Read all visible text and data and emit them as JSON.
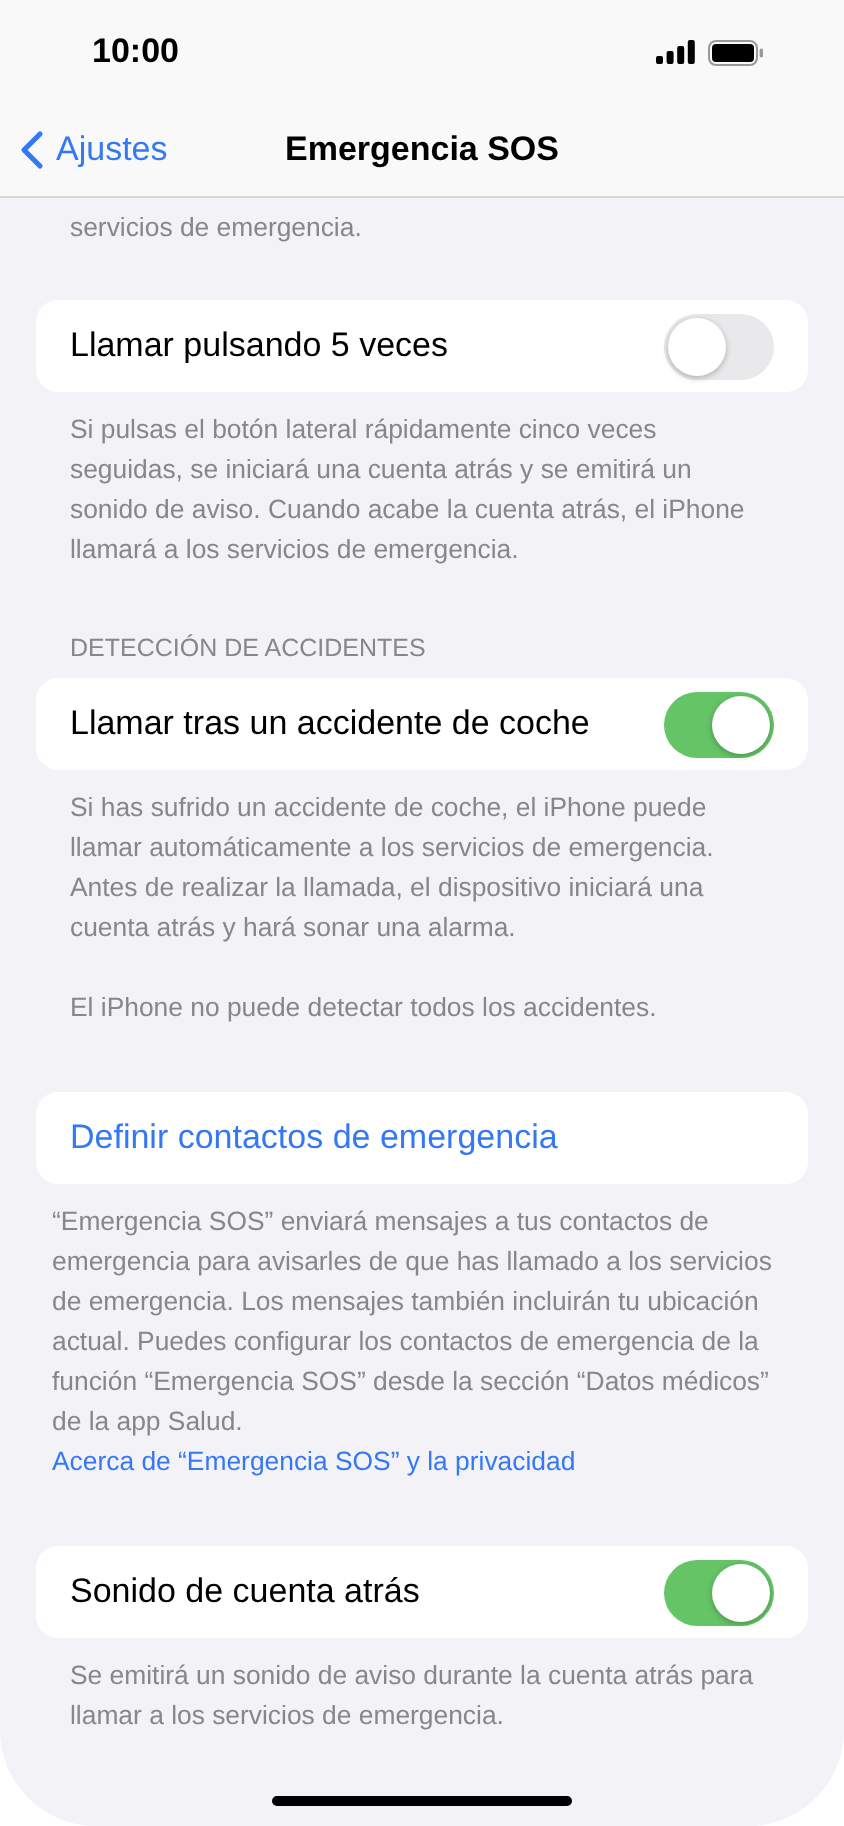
{
  "status_bar": {
    "time": "10:00"
  },
  "nav": {
    "back": "Ajustes",
    "title": "Emergencia SOS"
  },
  "top_note": "servicios de emergencia.",
  "sections": [
    {
      "row": {
        "kind": "toggle",
        "label": "Llamar pulsando 5 veces",
        "on": false
      },
      "footer": [
        "Si pulsas el botón lateral rápidamente cinco veces seguidas, se iniciará una cuenta atrás y se emitirá un sonido de aviso. Cuando acabe la cuenta atrás, el iPhone llamará a los servicios de emergencia."
      ]
    },
    {
      "header": "DETECCIÓN DE ACCIDENTES",
      "row": {
        "kind": "toggle",
        "label": "Llamar tras un accidente de coche",
        "on": true
      },
      "footer": [
        "Si has sufrido un accidente de coche, el iPhone puede llamar automáticamente a los servicios de emergencia. Antes de realizar la llamada, el dispositivo iniciará una cuenta atrás y hará sonar una alarma.",
        "El iPhone no puede detectar todos los accidentes."
      ]
    },
    {
      "row": {
        "kind": "link",
        "label": "Definir contactos de emergencia"
      },
      "footer": [
        "“Emergencia SOS” enviará mensajes a tus contactos de emergencia para avisarles de que has llamado a los servicios de emergencia. Los mensajes también incluirán tu ubicación actual. Puedes configurar los contactos de emergencia de la función “Emergencia SOS” desde la sección “Datos médicos” de la app Salud."
      ],
      "footer_link": "Acerca de “Emergencia SOS” y la privacidad"
    },
    {
      "row": {
        "kind": "toggle",
        "label": "Sonido de cuenta atrás",
        "on": true
      },
      "footer": [
        "Se emitirá un sonido de aviso durante la cuenta atrás para llamar a los servicios de emergencia."
      ]
    }
  ]
}
